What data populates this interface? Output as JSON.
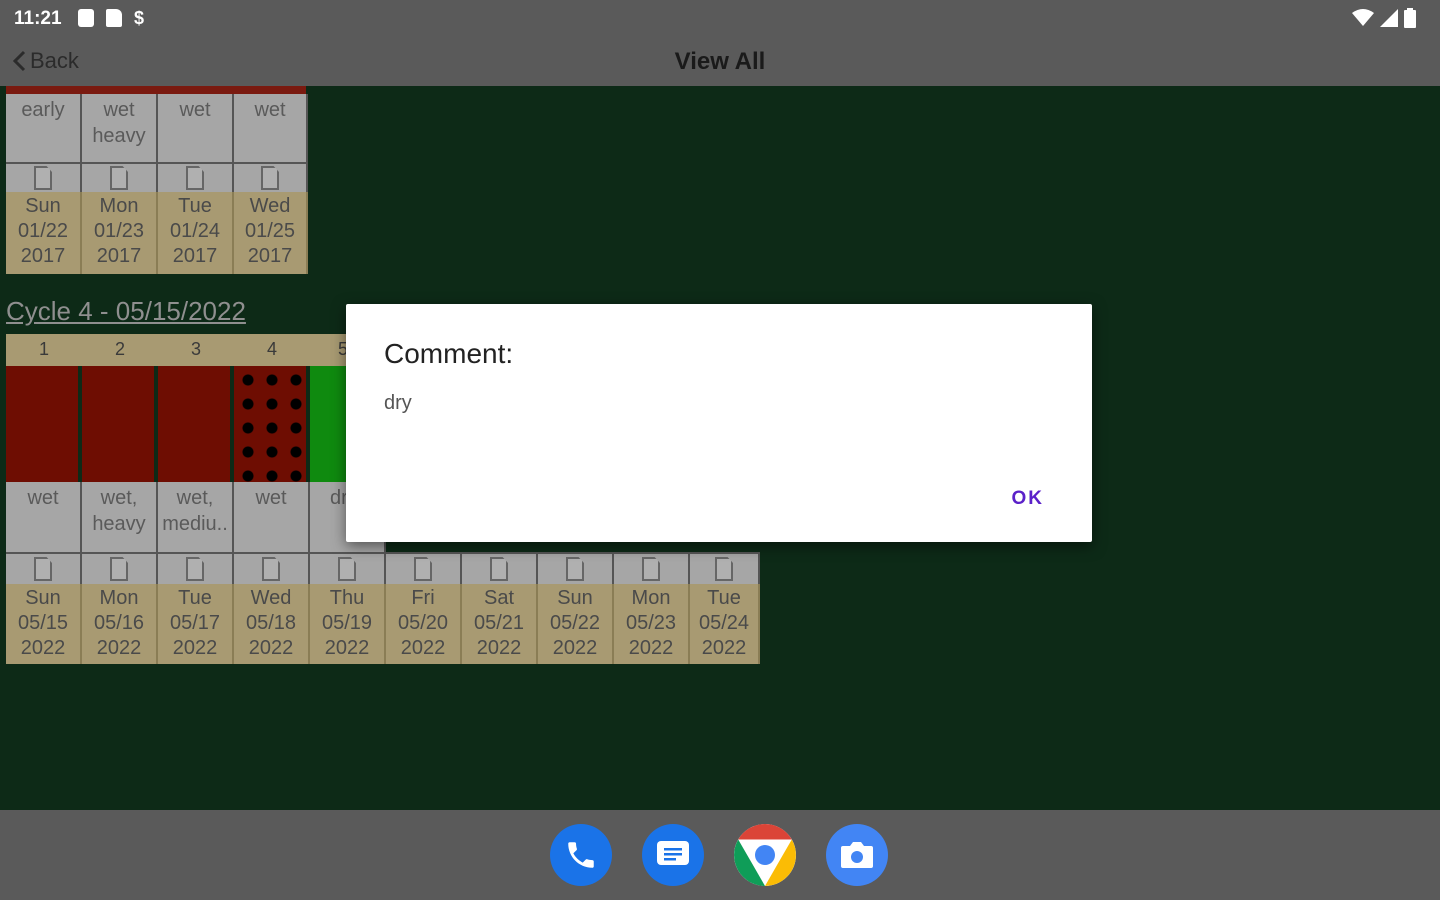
{
  "status": {
    "time": "11:21"
  },
  "appbar": {
    "back_label": "Back",
    "title": "View All"
  },
  "cycle3": {
    "comments": [
      "early",
      "wet\nheavy",
      "wet",
      "wet"
    ],
    "dates": [
      "Sun\n01/22\n2017",
      "Mon\n01/23\n2017",
      "Tue\n01/24\n2017",
      "Wed\n01/25\n2017"
    ]
  },
  "cycle4": {
    "title": "Cycle 4 - 05/15/2022",
    "day_numbers": [
      "1",
      "2",
      "3",
      "4",
      "5"
    ],
    "comments": [
      "wet",
      "wet,\nheavy",
      "wet,\nmediu..",
      "wet",
      "dr"
    ],
    "dates": [
      "Sun\n05/15\n2022",
      "Mon\n05/16\n2022",
      "Tue\n05/17\n2022",
      "Wed\n05/18\n2022",
      "Thu\n05/19\n2022",
      "Fri\n05/20\n2022",
      "Sat\n05/21\n2022",
      "Sun\n05/22\n2022",
      "Mon\n05/23\n2022",
      "Tue\n05/24\n2022"
    ]
  },
  "dialog": {
    "title": "Comment:",
    "message": "dry",
    "ok_label": "OK"
  },
  "dock": [
    "phone-icon",
    "messages-icon",
    "chrome-icon",
    "camera-icon"
  ],
  "colors": {
    "period_red": "#6e0d02",
    "green_day": "#0f8a0f",
    "background": "#0d2a17",
    "accent": "#5b21c9"
  }
}
